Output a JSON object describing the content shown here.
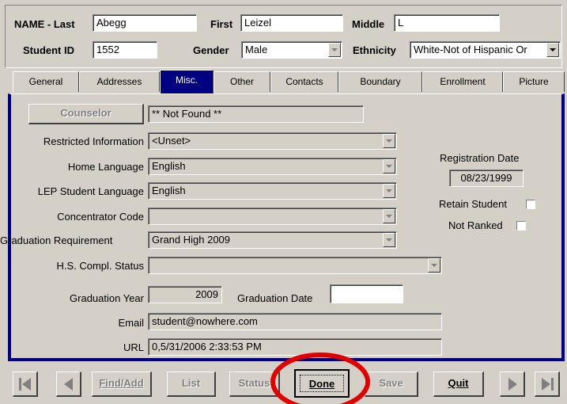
{
  "header": {
    "name_last_label": "NAME - Last",
    "name_last_value": "Abegg",
    "first_label": "First",
    "first_value": "Leizel",
    "middle_label": "Middle",
    "middle_value": "L",
    "student_id_label": "Student ID",
    "student_id_value": "1552",
    "gender_label": "Gender",
    "gender_value": "Male",
    "ethnicity_label": "Ethnicity",
    "ethnicity_value": "White-Not of Hispanic Or"
  },
  "tabs": [
    {
      "label": "General"
    },
    {
      "label": "Addresses"
    },
    {
      "label": "Misc."
    },
    {
      "label": "Other"
    },
    {
      "label": "Contacts"
    },
    {
      "label": "Boundary"
    },
    {
      "label": "Enrollment"
    },
    {
      "label": "Picture"
    }
  ],
  "active_tab": "Misc.",
  "misc": {
    "counselor_button": "Counselor",
    "counselor_value": "** Not Found **",
    "restricted_label": "Restricted Information",
    "restricted_value": "<Unset>",
    "home_language_label": "Home Language",
    "home_language_value": "English",
    "lep_label": "LEP Student Language",
    "lep_value": "English",
    "concentrator_label": "Concentrator Code",
    "concentrator_value": "",
    "grad_req_label": "Graduation Requirement",
    "grad_req_value": "Grand High 2009",
    "hs_compl_label": "H.S. Compl. Status",
    "hs_compl_value": "",
    "grad_year_label": "Graduation Year",
    "grad_year_value": "2009",
    "grad_date_label": "Graduation Date",
    "grad_date_value": "",
    "email_label": "Email",
    "email_value": "student@nowhere.com",
    "url_label": "URL",
    "url_value": "0,5/31/2006 2:33:53 PM",
    "reg_date_label": "Registration Date",
    "reg_date_value": "08/23/1999",
    "retain_label": "Retain Student",
    "not_ranked_label": "Not Ranked"
  },
  "toolbar": {
    "find_add": "Find/Add",
    "list": "List",
    "status": "Status",
    "done": "Done",
    "save": "Save",
    "quit": "Quit"
  },
  "colors": {
    "panel_border": "#000080",
    "highlight_circle": "#e00000"
  }
}
